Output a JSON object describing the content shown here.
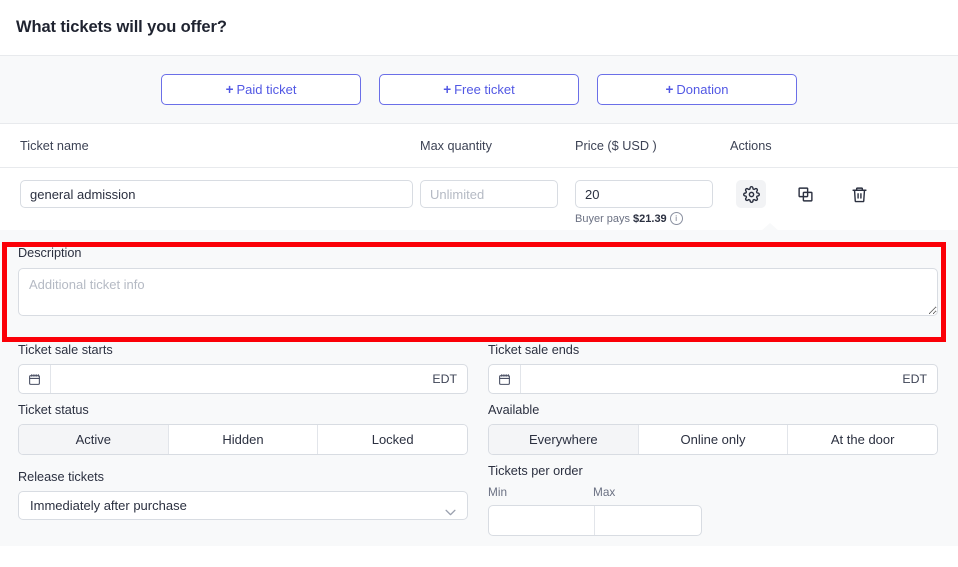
{
  "header": {
    "title": "What tickets will you offer?"
  },
  "add_buttons": [
    {
      "plus": "+",
      "label": "Paid ticket",
      "name": "add-paid-ticket-button"
    },
    {
      "plus": "+",
      "label": "Free ticket",
      "name": "add-free-ticket-button"
    },
    {
      "plus": "+",
      "label": "Donation",
      "name": "add-donation-button"
    }
  ],
  "table": {
    "columns": {
      "ticket_name": "Ticket name",
      "max_quantity": "Max quantity",
      "price": "Price ($ USD )",
      "actions": "Actions"
    },
    "row": {
      "ticket_name_value": "general admission",
      "max_quantity_value": "",
      "max_quantity_placeholder": "Unlimited",
      "price_value": "20",
      "price_placeholder": "",
      "buyer_pays_prefix": "Buyer pays",
      "buyer_pays_amount": "$21.39",
      "info_glyph": "i"
    },
    "actions": {
      "settings": "settings-gear-icon",
      "duplicate": "duplicate-copy-icon",
      "delete": "trash-delete-icon"
    }
  },
  "description": {
    "label": "Description",
    "value": "",
    "placeholder": "Additional ticket info"
  },
  "sale_dates": {
    "start_label": "Ticket sale starts",
    "start_value": "",
    "start_placeholder": "",
    "start_timezone": "EDT",
    "end_label": "Ticket sale ends",
    "end_value": "",
    "end_placeholder": "",
    "end_timezone": "EDT"
  },
  "ticket_status": {
    "label": "Ticket status",
    "options": [
      "Active",
      "Hidden",
      "Locked"
    ],
    "selected": "Active"
  },
  "available": {
    "label": "Available",
    "options": [
      "Everywhere",
      "Online only",
      "At the door"
    ],
    "selected": "Everywhere"
  },
  "release_tickets": {
    "label": "Release tickets",
    "selected": "Immediately after purchase"
  },
  "tickets_per_order": {
    "label": "Tickets per order",
    "min_label": "Min",
    "max_label": "Max",
    "min_value": "",
    "max_value": ""
  },
  "colors": {
    "accent": "#5258e4",
    "accent_border": "#6b6fe8",
    "panel_bg": "#f8f9fa",
    "border": "#d8dce2",
    "highlight": "#fb0007",
    "text": "#1f2330",
    "muted": "#6b7183"
  },
  "annotation": {
    "highlight_target": "description-section"
  }
}
